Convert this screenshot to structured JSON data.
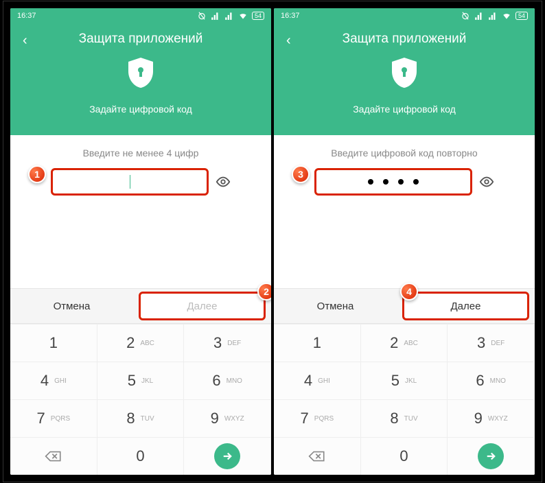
{
  "status": {
    "time": "16:37",
    "battery": "54"
  },
  "header": {
    "title": "Защита приложений",
    "subtitle": "Задайте цифровой код"
  },
  "screen1": {
    "hint": "Введите не менее 4 цифр"
  },
  "screen2": {
    "hint": "Введите цифровой код повторно"
  },
  "actions": {
    "cancel": "Отмена",
    "next": "Далее"
  },
  "keys": {
    "k1": "1",
    "k2": "2",
    "k2l": "ABC",
    "k3": "3",
    "k3l": "DEF",
    "k4": "4",
    "k4l": "GHI",
    "k5": "5",
    "k5l": "JKL",
    "k6": "6",
    "k6l": "MNO",
    "k7": "7",
    "k7l": "PQRS",
    "k8": "8",
    "k8l": "TUV",
    "k9": "9",
    "k9l": "WXYZ",
    "k0": "0"
  },
  "badges": {
    "b1": "1",
    "b2": "2",
    "b3": "3",
    "b4": "4"
  }
}
